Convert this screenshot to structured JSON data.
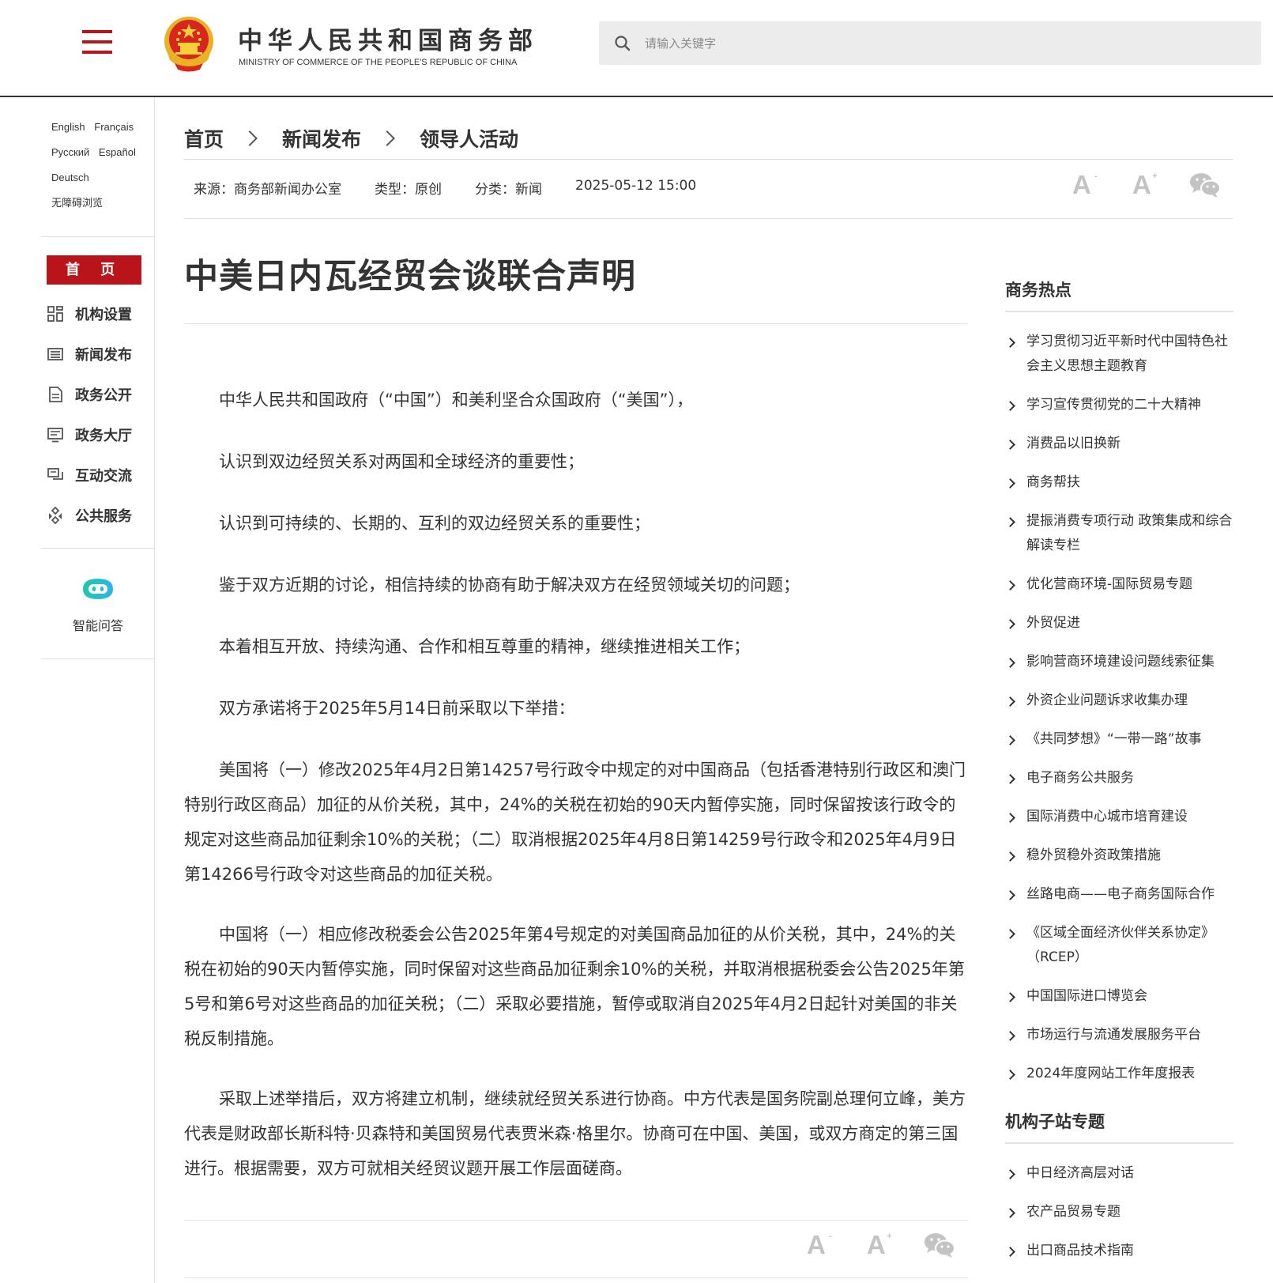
{
  "header": {
    "site_title_cn": "中华人民共和国商务部",
    "site_title_en": "MINISTRY OF COMMERCE OF THE PEOPLE'S REPUBLIC OF CHINA",
    "search_placeholder": "请输入关键字",
    "brand_color": "#b8141a"
  },
  "sidebar": {
    "languages": [
      [
        "English",
        "Français"
      ],
      [
        "Русский",
        "Español"
      ],
      [
        "Deutsch"
      ],
      [
        "无障碍浏览"
      ]
    ],
    "home_label": "首 页",
    "nav": [
      {
        "label": "机构设置",
        "icon": "grid-icon"
      },
      {
        "label": "新闻发布",
        "icon": "newspaper-icon"
      },
      {
        "label": "政务公开",
        "icon": "document-icon"
      },
      {
        "label": "政务大厅",
        "icon": "monitor-icon"
      },
      {
        "label": "互动交流",
        "icon": "chat-icon"
      },
      {
        "label": "公共服务",
        "icon": "service-icon"
      }
    ],
    "ai_label": "智能问答"
  },
  "breadcrumb": [
    "首页",
    "新闻发布",
    "领导人活动"
  ],
  "meta": {
    "source": "来源：商务部新闻办公室",
    "type": "类型：原创",
    "category": "分类：新闻",
    "datetime": "2025-05-12 15:00"
  },
  "tools": {
    "font_decrease": "A",
    "font_decrease_sup": "-",
    "font_increase": "A",
    "font_increase_sup": "+"
  },
  "article": {
    "title": "中美日内瓦经贸会谈联合声明",
    "paragraphs": [
      "中华人民共和国政府（“中国”）和美利坚合众国政府（“美国”），",
      "认识到双边经贸关系对两国和全球经济的重要性；",
      "认识到可持续的、长期的、互利的双边经贸关系的重要性；",
      "鉴于双方近期的讨论，相信持续的协商有助于解决双方在经贸领域关切的问题；",
      "本着相互开放、持续沟通、合作和相互尊重的精神，继续推进相关工作；",
      "双方承诺将于2025年5月14日前采取以下举措：",
      "美国将（一）修改2025年4月2日第14257号行政令中规定的对中国商品（包括香港特别行政区和澳门特别行政区商品）加征的从价关税，其中，24%的关税在初始的90天内暂停实施，同时保留按该行政令的规定对这些商品加征剩余10%的关税；（二）取消根据2025年4月8日第14259号行政令和2025年4月9日第14266号行政令对这些商品的加征关税。",
      "中国将（一）相应修改税委会公告2025年第4号规定的对美国商品加征的从价关税，其中，24%的关税在初始的90天内暂停实施，同时保留对这些商品加征剩余10%的关税，并取消根据税委会公告2025年第5号和第6号对这些商品的加征关税；（二）采取必要措施，暂停或取消自2025年4月2日起针对美国的非关税反制措施。",
      "采取上述举措后，双方将建立机制，继续就经贸关系进行协商。中方代表是国务院副总理何立峰，美方代表是财政部长斯科特·贝森特和美国贸易代表贾米森·格里尔。协商可在中国、美国，或双方商定的第三国进行。根据需要，双方可就相关经贸议题开展工作层面磋商。"
    ]
  },
  "right": {
    "hot_heading": "商务热点",
    "hot_items": [
      "学习贯彻习近平新时代中国特色社会主义思想主题教育",
      "学习宣传贯彻党的二十大精神",
      "消费品以旧换新",
      "商务帮扶",
      "提振消费专项行动 政策集成和综合解读专栏",
      "优化营商环境-国际贸易专题",
      "外贸促进",
      "影响营商环境建设问题线索征集",
      "外资企业问题诉求收集办理",
      "《共同梦想》“一带一路”故事",
      "电子商务公共服务",
      "国际消费中心城市培育建设",
      "稳外贸稳外资政策措施",
      "丝路电商——电子商务国际合作",
      "《区域全面经济伙伴关系协定》（RCEP）",
      "中国国际进口博览会",
      "市场运行与流通发展服务平台",
      "2024年度网站工作年度报表"
    ],
    "sub_heading": "机构子站专题",
    "sub_items": [
      "中日经济高层对话",
      "农产品贸易专题",
      "出口商品技术指南"
    ]
  }
}
